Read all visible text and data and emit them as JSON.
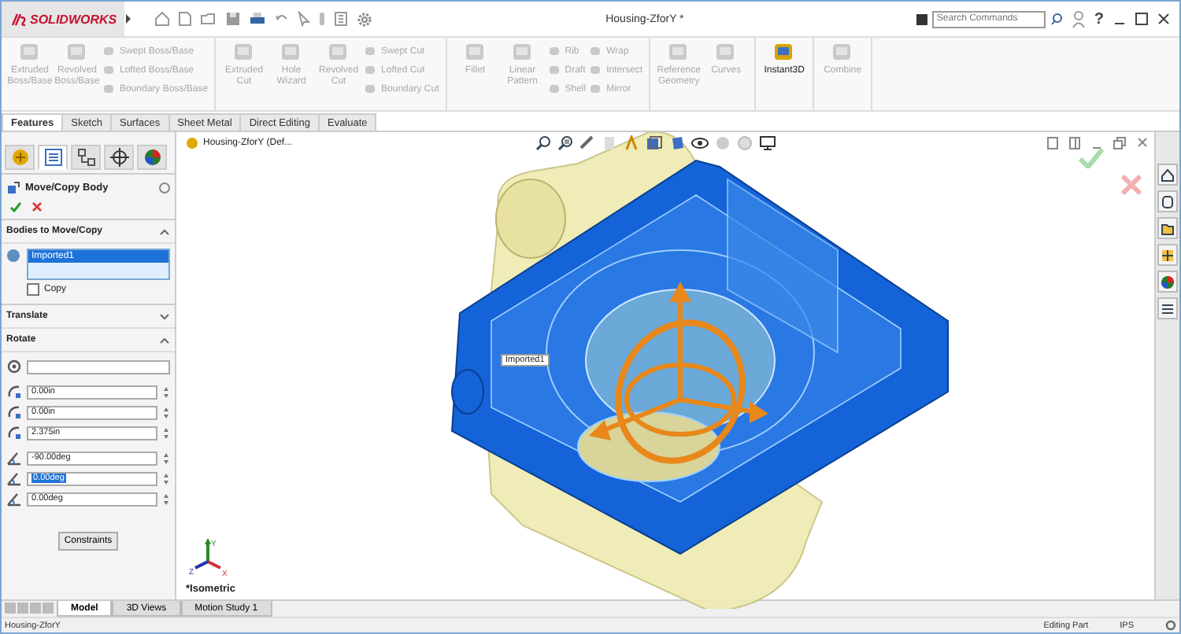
{
  "title_bar": {
    "logo": "SOLIDWORKS",
    "title": "Housing-ZforY *",
    "search": {
      "placeholder": "Search Commands"
    },
    "help": "?"
  },
  "ribbon": [
    {
      "items": [
        {
          "kind": "large",
          "label": "Extruded Boss/Base",
          "disabled": true
        },
        {
          "kind": "large",
          "label": "Revolved Boss/Base",
          "disabled": true
        },
        {
          "kind": "stack",
          "items": [
            {
              "label": "Swept Boss/Base",
              "disabled": true
            },
            {
              "label": "Lofted Boss/Base",
              "disabled": true
            },
            {
              "label": "Boundary Boss/Base",
              "disabled": true
            }
          ]
        }
      ]
    },
    {
      "items": [
        {
          "kind": "large",
          "label": "Extruded Cut",
          "disabled": true
        },
        {
          "kind": "large",
          "label": "Hole Wizard",
          "disabled": true
        },
        {
          "kind": "large",
          "label": "Revolved Cut",
          "disabled": true
        },
        {
          "kind": "stack",
          "items": [
            {
              "label": "Swept Cut",
              "disabled": true
            },
            {
              "label": "Lofted Cut",
              "disabled": true
            },
            {
              "label": "Boundary Cut",
              "disabled": true
            }
          ]
        }
      ]
    },
    {
      "items": [
        {
          "kind": "large",
          "label": "Fillet",
          "disabled": true
        },
        {
          "kind": "large",
          "label": "Linear Pattern",
          "disabled": true
        },
        {
          "kind": "stack",
          "items": [
            {
              "label": "Rib",
              "disabled": true
            },
            {
              "label": "Draft",
              "disabled": true
            },
            {
              "label": "Shell",
              "disabled": true
            }
          ]
        },
        {
          "kind": "stack",
          "items": [
            {
              "label": "Wrap",
              "disabled": true
            },
            {
              "label": "Intersect",
              "disabled": true
            },
            {
              "label": "Mirror",
              "disabled": true
            }
          ]
        }
      ]
    },
    {
      "items": [
        {
          "kind": "large",
          "label": "Reference Geometry",
          "disabled": true
        },
        {
          "kind": "large",
          "label": "Curves",
          "disabled": true
        }
      ]
    },
    {
      "items": [
        {
          "kind": "large",
          "label": "Instant3D",
          "disabled": false
        }
      ]
    },
    {
      "items": [
        {
          "kind": "large",
          "label": "Combine",
          "disabled": true
        }
      ]
    }
  ],
  "command_tabs": [
    {
      "label": "Features",
      "selected": true
    },
    {
      "label": "Sketch",
      "selected": false
    },
    {
      "label": "Surfaces",
      "selected": false
    },
    {
      "label": "Sheet Metal",
      "selected": false
    },
    {
      "label": "Direct Editing",
      "selected": false
    },
    {
      "label": "Evaluate",
      "selected": false
    }
  ],
  "property_manager": {
    "tabs": [
      {
        "kind": "tree",
        "selected": false
      },
      {
        "kind": "properties",
        "selected": true
      },
      {
        "kind": "config",
        "selected": false
      },
      {
        "kind": "dimxpert",
        "selected": false
      },
      {
        "kind": "display",
        "selected": false
      }
    ],
    "title": "Move/Copy Body",
    "bodies": {
      "header": "Bodies to Move/Copy",
      "expanded": true,
      "items": [
        {
          "label": "Imported1",
          "selected": true
        }
      ],
      "copy": {
        "label": "Copy",
        "checked": false
      }
    },
    "translate": {
      "header": "Translate",
      "expanded": false
    },
    "rotate": {
      "header": "Rotate",
      "expanded": true,
      "fields": [
        {
          "kind": "point",
          "selected": false
        },
        {
          "kind": "distance",
          "value": "0.00in",
          "selected": false
        },
        {
          "kind": "distance",
          "value": "0.00in",
          "selected": false
        },
        {
          "kind": "distance",
          "value": "2.375in",
          "selected": false
        },
        {
          "kind": "angle",
          "value": "-90.00deg",
          "selected": false
        },
        {
          "kind": "angle",
          "value": "0.00deg",
          "selected": true
        },
        {
          "kind": "angle",
          "value": "0.00deg",
          "selected": false
        }
      ]
    },
    "constraints_button": "Constraints"
  },
  "viewport": {
    "tree_root": "Housing-ZforY  (Def...",
    "body_tag": "Imported1",
    "view_name": "*Isometric",
    "axes": [
      "Y",
      "Z",
      "X"
    ]
  },
  "bottom_tabs": [
    {
      "label": "Model",
      "selected": true
    },
    {
      "label": "3D Views",
      "selected": false
    },
    {
      "label": "Motion Study 1",
      "selected": false
    }
  ],
  "status_bar": {
    "document": "Housing-ZforY",
    "mode": "Editing Part",
    "units": "IPS"
  }
}
